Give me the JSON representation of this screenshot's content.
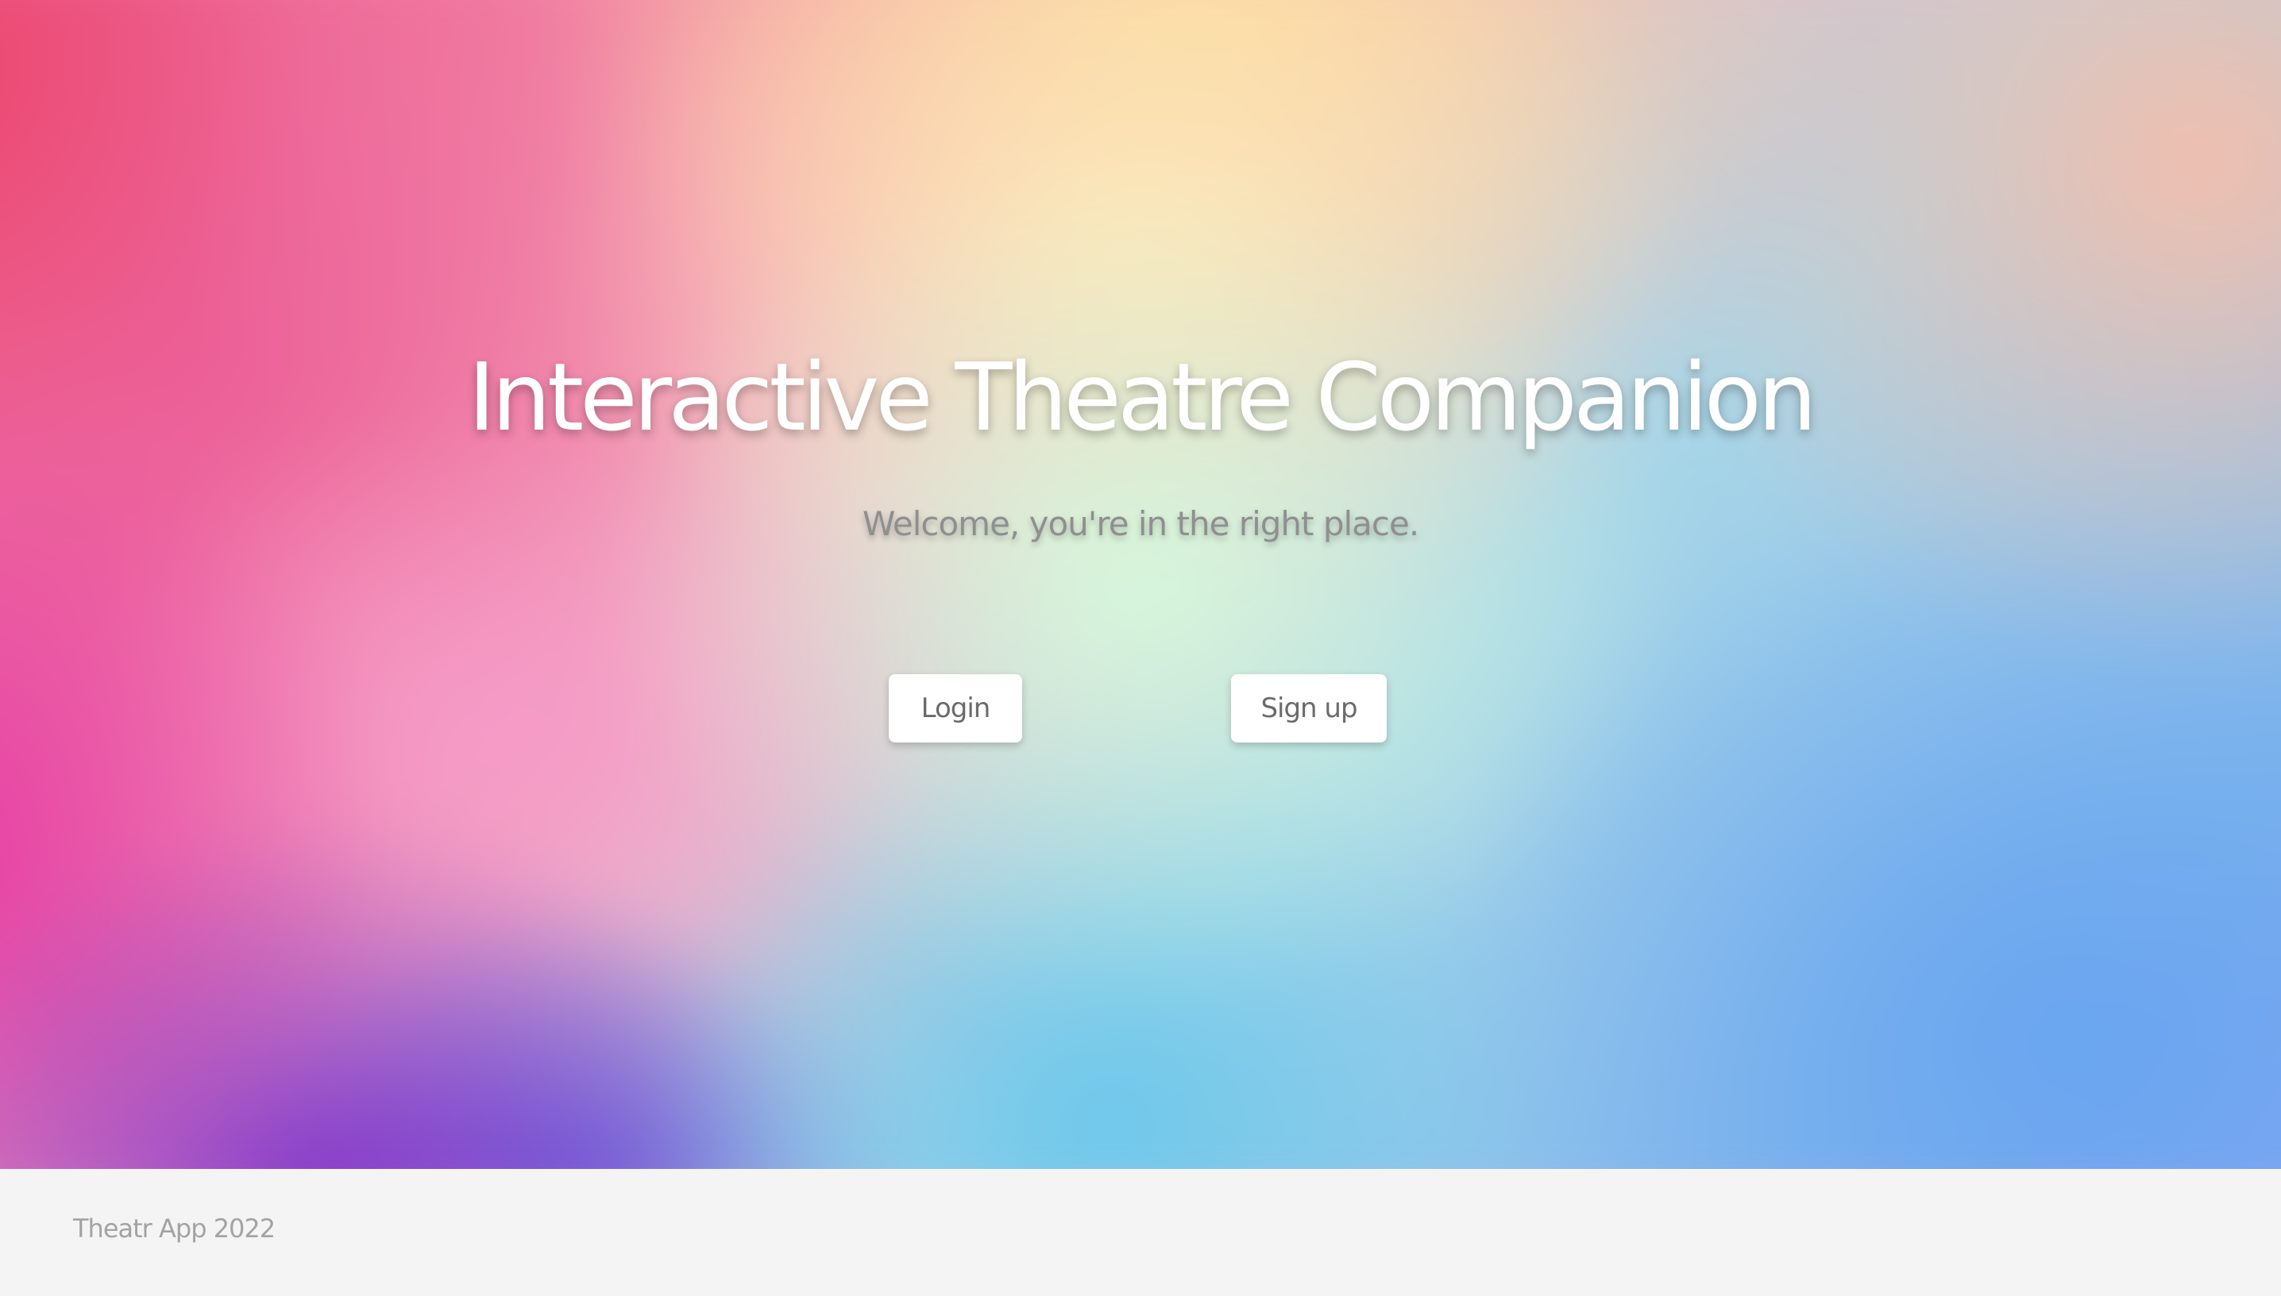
{
  "hero": {
    "title": "Interactive Theatre Companion",
    "subtitle": "Welcome, you're in the right place.",
    "buttons": {
      "login_label": "Login",
      "signup_label": "Sign up"
    }
  },
  "footer": {
    "text": "Theatr App 2022"
  },
  "colors": {
    "title": "#ffffff",
    "subtitle": "#8f8f90",
    "button_bg": "#ffffff",
    "button_text": "#6b6b6b",
    "footer_bg": "#f4f4f4",
    "footer_text": "#a3a3a3"
  }
}
